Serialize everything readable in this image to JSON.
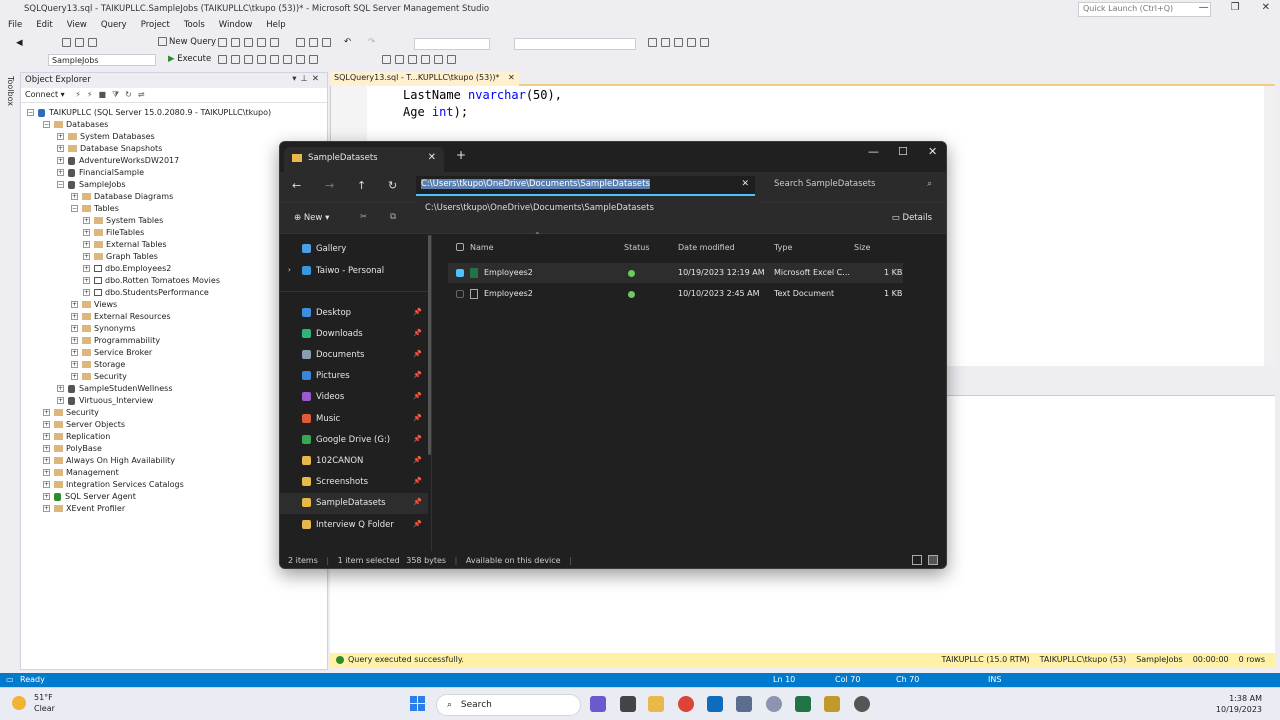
{
  "window": {
    "title": "SQLQuery13.sql - TAIKUPLLC.SampleJobs (TAIKUPLLC\\tkupo (53))* - Microsoft SQL Server Management Studio",
    "quick_launch_placeholder": "Quick Launch (Ctrl+Q)"
  },
  "menu": [
    "File",
    "Edit",
    "View",
    "Query",
    "Project",
    "Tools",
    "Window",
    "Help"
  ],
  "toolbar": {
    "new_query": "New Query",
    "database": "SampleJobs",
    "execute": "Execute"
  },
  "toolstrip_label": "Toolbox",
  "object_explorer": {
    "title": "Object Explorer",
    "connect": "Connect",
    "server": "TAIKUPLLC (SQL Server 15.0.2080.9 - TAIKUPLLC\\tkupo)",
    "nodes": [
      {
        "label": "Databases",
        "level": 1,
        "type": "folder",
        "exp": "−"
      },
      {
        "label": "System Databases",
        "level": 2,
        "type": "folder",
        "exp": "+"
      },
      {
        "label": "Database Snapshots",
        "level": 2,
        "type": "folder",
        "exp": "+"
      },
      {
        "label": "AdventureWorksDW2017",
        "level": 2,
        "type": "db",
        "exp": "+"
      },
      {
        "label": "FinancialSample",
        "level": 2,
        "type": "db",
        "exp": "+"
      },
      {
        "label": "SampleJobs",
        "level": 2,
        "type": "db",
        "exp": "−"
      },
      {
        "label": "Database Diagrams",
        "level": 3,
        "type": "folder",
        "exp": "+"
      },
      {
        "label": "Tables",
        "level": 3,
        "type": "folder",
        "exp": "−"
      },
      {
        "label": "System Tables",
        "level": 4,
        "type": "folder",
        "exp": "+"
      },
      {
        "label": "FileTables",
        "level": 4,
        "type": "folder",
        "exp": "+"
      },
      {
        "label": "External Tables",
        "level": 4,
        "type": "folder",
        "exp": "+"
      },
      {
        "label": "Graph Tables",
        "level": 4,
        "type": "folder",
        "exp": "+"
      },
      {
        "label": "dbo.Employees2",
        "level": 4,
        "type": "tbl",
        "exp": "+"
      },
      {
        "label": "dbo.Rotten Tomatoes Movies",
        "level": 4,
        "type": "tbl",
        "exp": "+"
      },
      {
        "label": "dbo.StudentsPerformance",
        "level": 4,
        "type": "tbl",
        "exp": "+"
      },
      {
        "label": "Views",
        "level": 3,
        "type": "folder",
        "exp": "+"
      },
      {
        "label": "External Resources",
        "level": 3,
        "type": "folder",
        "exp": "+"
      },
      {
        "label": "Synonyms",
        "level": 3,
        "type": "folder",
        "exp": "+"
      },
      {
        "label": "Programmability",
        "level": 3,
        "type": "folder",
        "exp": "+"
      },
      {
        "label": "Service Broker",
        "level": 3,
        "type": "folder",
        "exp": "+"
      },
      {
        "label": "Storage",
        "level": 3,
        "type": "folder",
        "exp": "+"
      },
      {
        "label": "Security",
        "level": 3,
        "type": "folder",
        "exp": "+"
      },
      {
        "label": "SampleStudenWellness",
        "level": 2,
        "type": "db",
        "exp": "+"
      },
      {
        "label": "Virtuous_Interview",
        "level": 2,
        "type": "db",
        "exp": "+"
      },
      {
        "label": "Security",
        "level": 1,
        "type": "folder",
        "exp": "+"
      },
      {
        "label": "Server Objects",
        "level": 1,
        "type": "folder",
        "exp": "+"
      },
      {
        "label": "Replication",
        "level": 1,
        "type": "folder",
        "exp": "+"
      },
      {
        "label": "PolyBase",
        "level": 1,
        "type": "folder",
        "exp": "+"
      },
      {
        "label": "Always On High Availability",
        "level": 1,
        "type": "folder",
        "exp": "+"
      },
      {
        "label": "Management",
        "level": 1,
        "type": "folder",
        "exp": "+"
      },
      {
        "label": "Integration Services Catalogs",
        "level": 1,
        "type": "folder",
        "exp": "+"
      },
      {
        "label": "SQL Server Agent",
        "level": 1,
        "type": "agent",
        "exp": "+"
      },
      {
        "label": "XEvent Profiler",
        "level": 1,
        "type": "folder",
        "exp": "+"
      }
    ]
  },
  "editor": {
    "tab": "SQLQuery13.sql - T...KUPLLC\\tkupo (53))*",
    "line1_name": "LastName",
    "line1_type": "nvarchar",
    "line1_rest": "(50),",
    "line2_name": "Age",
    "line2_type": "int",
    "line2_rest": ");"
  },
  "query_status": {
    "message": "Query executed successfully.",
    "server": "TAIKUPLLC (15.0 RTM)",
    "user": "TAIKUPLLC\\tkupo (53)",
    "db": "SampleJobs",
    "time": "00:00:00",
    "rows": "0 rows"
  },
  "statusbar": {
    "ready": "Ready",
    "ln": "Ln 10",
    "col": "Col 70",
    "ch": "Ch 70",
    "ins": "INS"
  },
  "explorer": {
    "tab_title": "SampleDatasets",
    "address": "C:\\Users\\tkupo\\OneDrive\\Documents\\SampleDatasets",
    "suggestion": "C:\\Users\\tkupo\\OneDrive\\Documents\\SampleDatasets",
    "search_placeholder": "Search SampleDatasets",
    "new_label": "New",
    "details_label": "Details",
    "sidebar": [
      {
        "label": "Gallery",
        "color": "#4aa0e6",
        "pin": false
      },
      {
        "label": "Taiwo - Personal",
        "color": "#3a96dd",
        "pin": false
      },
      {
        "label": "Desktop",
        "color": "#3c8fe0",
        "pin": true
      },
      {
        "label": "Downloads",
        "color": "#2fb37a",
        "pin": true
      },
      {
        "label": "Documents",
        "color": "#8a9ab0",
        "pin": true
      },
      {
        "label": "Pictures",
        "color": "#3a86d8",
        "pin": true
      },
      {
        "label": "Videos",
        "color": "#9b5bd0",
        "pin": true
      },
      {
        "label": "Music",
        "color": "#e05a3a",
        "pin": true
      },
      {
        "label": "Google Drive (G:)",
        "color": "#34a853",
        "pin": true
      },
      {
        "label": "102CANON",
        "color": "#e8b848",
        "pin": true
      },
      {
        "label": "Screenshots",
        "color": "#e8b848",
        "pin": true
      },
      {
        "label": "SampleDatasets",
        "color": "#e8b848",
        "pin": true
      },
      {
        "label": "Interview Q Folder",
        "color": "#e8b848",
        "pin": true
      }
    ],
    "columns": [
      "Name",
      "Status",
      "Date modified",
      "Type",
      "Size"
    ],
    "files": [
      {
        "name": "Employees2",
        "date": "10/19/2023 12:19 AM",
        "type": "Microsoft Excel C...",
        "size": "1 KB",
        "selected": true
      },
      {
        "name": "Employees2",
        "date": "10/10/2023 2:45 AM",
        "type": "Text Document",
        "size": "1 KB",
        "selected": false
      }
    ],
    "status": {
      "items": "2 items",
      "selected": "1 item selected",
      "bytes": "358 bytes",
      "availability": "Available on this device"
    }
  },
  "taskbar": {
    "temp": "51°F",
    "weather": "Clear",
    "search": "Search",
    "time": "1:38 AM",
    "date": "10/19/2023"
  }
}
